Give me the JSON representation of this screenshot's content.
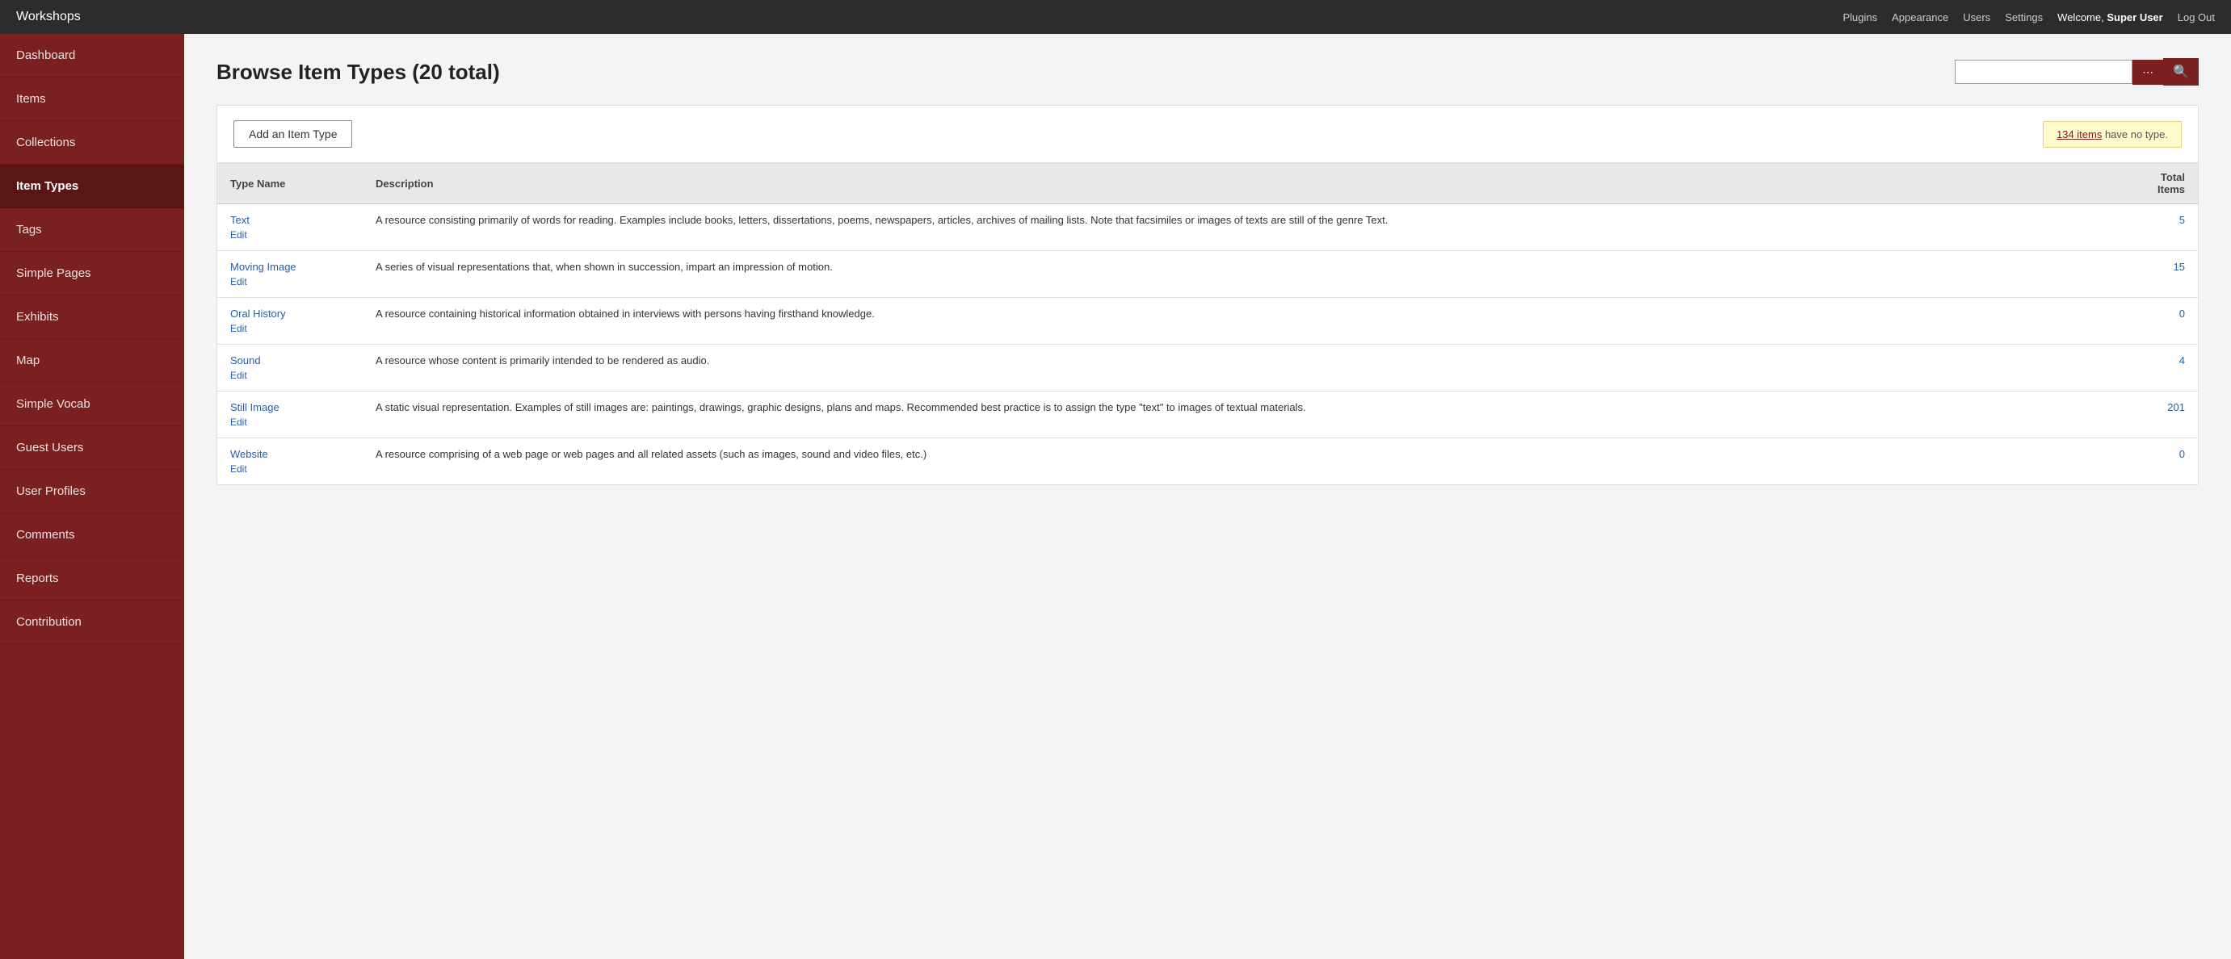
{
  "topNav": {
    "siteTitle": "Workshops",
    "links": [
      {
        "label": "Plugins",
        "name": "plugins-link"
      },
      {
        "label": "Appearance",
        "name": "appearance-link"
      },
      {
        "label": "Users",
        "name": "users-link"
      },
      {
        "label": "Settings",
        "name": "settings-link"
      }
    ],
    "welcome": "Welcome,",
    "userName": "Super User",
    "logout": "Log Out"
  },
  "sidebar": {
    "items": [
      {
        "label": "Dashboard",
        "name": "sidebar-item-dashboard",
        "active": false
      },
      {
        "label": "Items",
        "name": "sidebar-item-items",
        "active": false
      },
      {
        "label": "Collections",
        "name": "sidebar-item-collections",
        "active": false
      },
      {
        "label": "Item Types",
        "name": "sidebar-item-item-types",
        "active": true
      },
      {
        "label": "Tags",
        "name": "sidebar-item-tags",
        "active": false
      },
      {
        "label": "Simple Pages",
        "name": "sidebar-item-simple-pages",
        "active": false
      },
      {
        "label": "Exhibits",
        "name": "sidebar-item-exhibits",
        "active": false
      },
      {
        "label": "Map",
        "name": "sidebar-item-map",
        "active": false
      },
      {
        "label": "Simple Vocab",
        "name": "sidebar-item-simple-vocab",
        "active": false
      },
      {
        "label": "Guest Users",
        "name": "sidebar-item-guest-users",
        "active": false
      },
      {
        "label": "User Profiles",
        "name": "sidebar-item-user-profiles",
        "active": false
      },
      {
        "label": "Comments",
        "name": "sidebar-item-comments",
        "active": false
      },
      {
        "label": "Reports",
        "name": "sidebar-item-reports",
        "active": false
      },
      {
        "label": "Contribution",
        "name": "sidebar-item-contribution",
        "active": false
      }
    ]
  },
  "main": {
    "pageTitle": "Browse Item Types (20 total)",
    "searchPlaceholder": "",
    "addButtonLabel": "Add an Item Type",
    "noTypeNotice": {
      "linkText": "134 items",
      "suffix": " have no type."
    },
    "table": {
      "headers": [
        "Type Name",
        "Description",
        "Total Items"
      ],
      "rows": [
        {
          "typeName": "Text",
          "editLabel": "Edit",
          "description": "A resource consisting primarily of words for reading. Examples include books, letters, dissertations, poems, newspapers, articles, archives of mailing lists. Note that facsimiles or images of texts are still of the genre Text.",
          "total": "5"
        },
        {
          "typeName": "Moving Image",
          "editLabel": "Edit",
          "description": "A series of visual representations that, when shown in succession, impart an impression of motion.",
          "total": "15"
        },
        {
          "typeName": "Oral History",
          "editLabel": "Edit",
          "description": "A resource containing historical information obtained in interviews with persons having firsthand knowledge.",
          "total": "0"
        },
        {
          "typeName": "Sound",
          "editLabel": "Edit",
          "description": "A resource whose content is primarily intended to be rendered as audio.",
          "total": "4"
        },
        {
          "typeName": "Still Image",
          "editLabel": "Edit",
          "description": "A static visual representation. Examples of still images are: paintings, drawings, graphic designs, plans and maps. Recommended best practice is to assign the type \"text\" to images of textual materials.",
          "total": "201"
        },
        {
          "typeName": "Website",
          "editLabel": "Edit",
          "description": "A resource comprising of a web page or web pages and all related assets (such as images, sound and video files, etc.)",
          "total": "0"
        }
      ]
    }
  }
}
